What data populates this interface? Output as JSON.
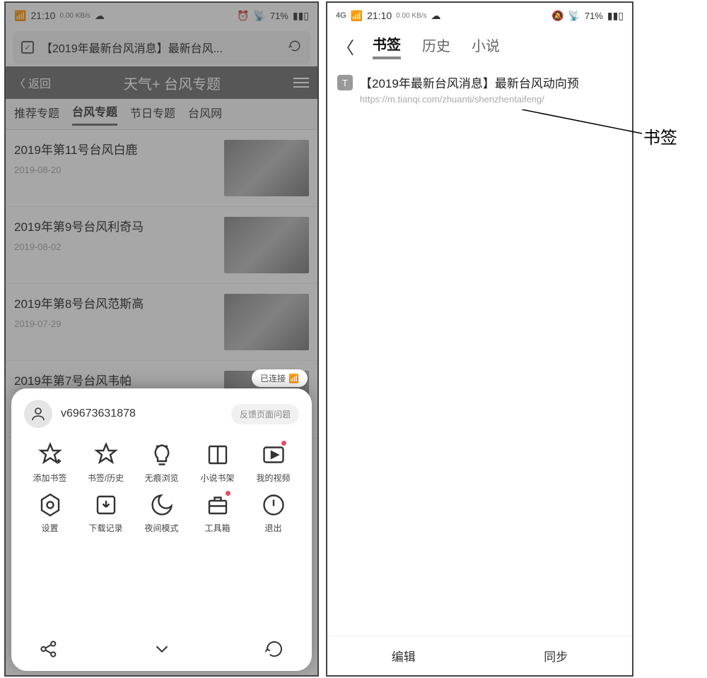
{
  "status": {
    "time": "21:10",
    "net": "0.00 KB/s",
    "signal": "4G",
    "battery": "71%"
  },
  "left": {
    "url_title": "【2019年最新台风消息】最新台风...",
    "nav_back": "返回",
    "nav_title": "天气+ 台风专题",
    "category_tabs": [
      "推荐专题",
      "台风专题",
      "节日专题",
      "台风网"
    ],
    "active_tab_index": 1,
    "articles": [
      {
        "title": "2019年第11号台风白鹿",
        "date": "2019-08-20"
      },
      {
        "title": "2019年第9号台风利奇马",
        "date": "2019-08-02"
      },
      {
        "title": "2019年第8号台风范斯高",
        "date": "2019-07-29"
      },
      {
        "title": "2019年第7号台风韦帕",
        "date": ""
      }
    ],
    "connected_label": "已连接",
    "sheet": {
      "username": "v69673631878",
      "feedback": "反馈页面问题",
      "items": [
        {
          "icon": "star-plus",
          "label": "添加书签",
          "dot": false
        },
        {
          "icon": "star",
          "label": "书签/历史",
          "dot": false
        },
        {
          "icon": "bulb",
          "label": "无痕浏览",
          "dot": false
        },
        {
          "icon": "book",
          "label": "小说书架",
          "dot": false
        },
        {
          "icon": "video",
          "label": "我的视频",
          "dot": true
        },
        {
          "icon": "hex-gear",
          "label": "设置",
          "dot": false
        },
        {
          "icon": "download",
          "label": "下载记录",
          "dot": false
        },
        {
          "icon": "moon",
          "label": "夜间模式",
          "dot": false
        },
        {
          "icon": "toolbox",
          "label": "工具箱",
          "dot": true
        },
        {
          "icon": "power",
          "label": "退出",
          "dot": false
        }
      ]
    }
  },
  "right": {
    "tabs": [
      "书签",
      "历史",
      "小说"
    ],
    "active_tab_index": 0,
    "bookmarks": [
      {
        "badge": "T",
        "title": "【2019年最新台风消息】最新台风动向预",
        "url": "https://m.tianqi.com/zhuanti/shenzhentaifeng/"
      }
    ],
    "footer": {
      "edit": "编辑",
      "sync": "同步"
    }
  },
  "annotation": "书签"
}
